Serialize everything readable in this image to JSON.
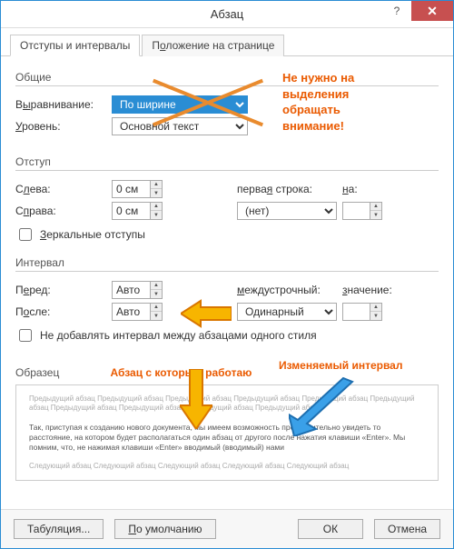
{
  "window": {
    "title": "Абзац",
    "help": "?",
    "close": "✕"
  },
  "tabs": {
    "t1": "Отступы и интервалы",
    "t2_pre": "П",
    "t2_hot": "о",
    "t2_post": "ложение на странице"
  },
  "groups": {
    "general": "Общие",
    "indent": "Отступ",
    "spacing": "Интервал",
    "sample": "Образец"
  },
  "general": {
    "align_pre": "В",
    "align_hot": "ы",
    "align_post": "равнивание:",
    "align_val": "По ширине",
    "level_pre": "",
    "level_hot": "У",
    "level_post": "ровень:",
    "level_val": "Основной текст"
  },
  "note": {
    "l1": "Не нужно на",
    "l2": "выделения",
    "l3": "обращать",
    "l4": "внимание!"
  },
  "indent": {
    "left_pre": "С",
    "left_hot": "л",
    "left_post": "ева:",
    "left_val": "0 см",
    "right_pre": "С",
    "right_hot": "п",
    "right_post": "рава:",
    "right_val": "0 см",
    "first_pre": "перва",
    "first_hot": "я",
    "first_post": " строка:",
    "first_val": "(нет)",
    "by_pre": "",
    "by_hot": "н",
    "by_post": "а:",
    "by_val": "",
    "mirror_pre": "",
    "mirror_hot": "З",
    "mirror_post": "еркальные отступы"
  },
  "spacing": {
    "before_pre": "П",
    "before_hot": "е",
    "before_post": "ред:",
    "before_val": "Авто",
    "after_pre": "П",
    "after_hot": "о",
    "after_post": "сле:",
    "after_val": "Авто",
    "line_pre": "",
    "line_hot": "м",
    "line_post": "еждустрочный:",
    "line_val": "Одинарный",
    "at_pre": "",
    "at_hot": "з",
    "at_post": "начение:",
    "at_val": "",
    "nospace": "Не добавлять интервал между абзацами одного стиля"
  },
  "captions": {
    "working": "Абзац с которым работаю",
    "changing": "Изменяемый интервал"
  },
  "sample": {
    "prev": "Предыдущий абзац Предыдущий абзац Предыдущий абзац Предыдущий абзац Предыдущий абзац Предыдущий абзац Предыдущий абзац Предыдущий абзац Предыдущий абзац Предыдущий абзац",
    "mid": "Так, приступая к созданию нового документа, мы имеем возможность предварительно увидеть то расстояние, на котором будет располагаться один абзац от другого после нажатия клавиши «Enter». Мы помним, что, не нажимая клавиши «Enter» вводимый (вводимый) нами",
    "next": "Следующий абзац Следующий абзац Следующий абзац Следующий абзац Следующий абзац"
  },
  "footer": {
    "tabs": "Табуляция...",
    "default_pre": "",
    "default_hot": "П",
    "default_post": "о умолчанию",
    "ok": "ОК",
    "cancel": "Отмена"
  }
}
